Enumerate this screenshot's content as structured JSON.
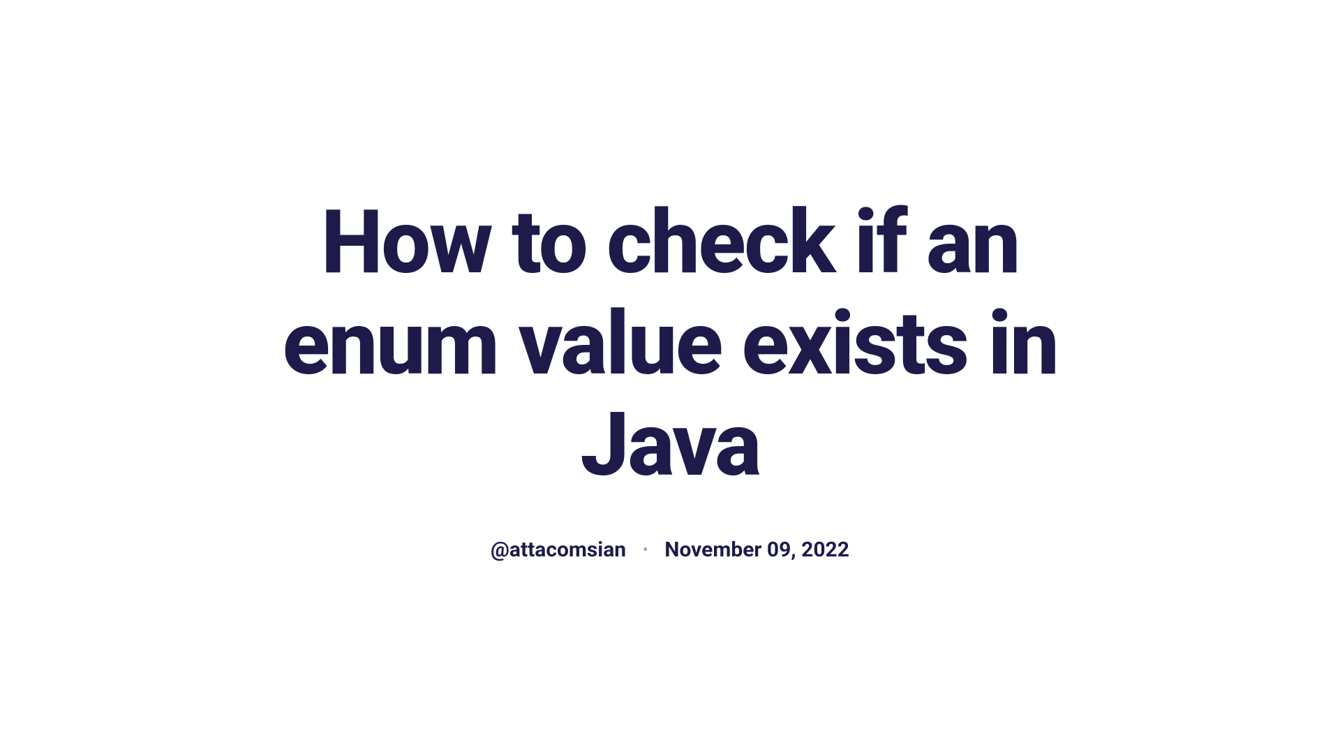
{
  "article": {
    "title": "How to check if an enum value exists in Java",
    "author": "@attacomsian",
    "date": "November 09, 2022"
  }
}
